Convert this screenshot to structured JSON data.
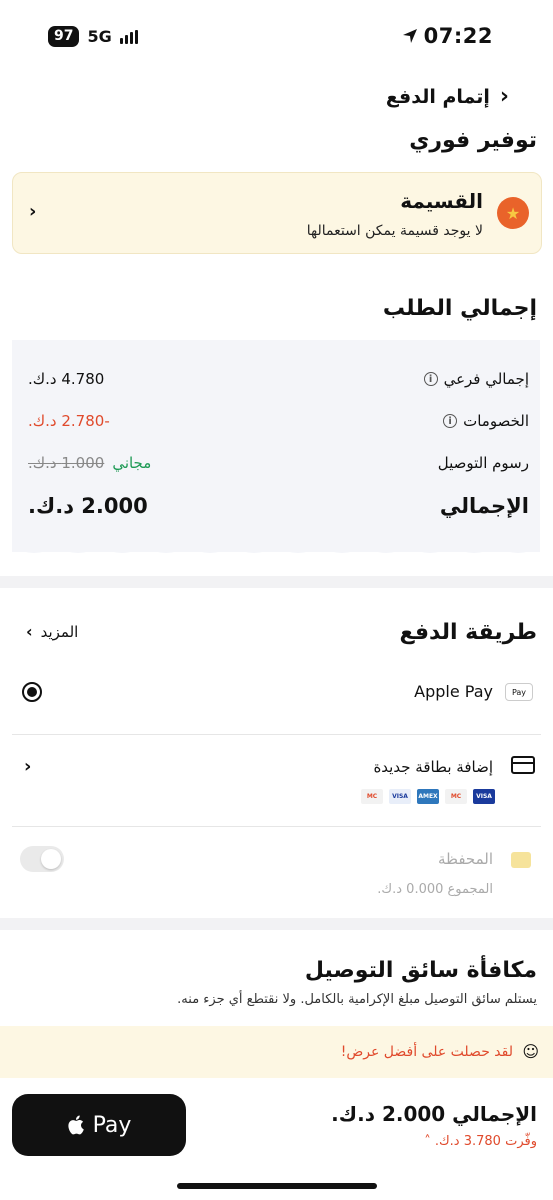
{
  "status_bar": {
    "battery": "97",
    "network": "5G",
    "time": "07:22"
  },
  "header": {
    "title": "إتمام الدفع"
  },
  "instant_savings": {
    "title": "توفير فوري",
    "coupon_title": "القسيمة",
    "coupon_subtitle": "لا يوجد قسيمة يمكن استعمالها"
  },
  "order_summary": {
    "title": "إجمالي الطلب",
    "rows": [
      {
        "label": "إجمالي فرعي",
        "value": "4.780 د.ك."
      },
      {
        "label": "الخصومات",
        "value": "-2.780 د.ك."
      },
      {
        "label": "رسوم التوصيل",
        "original": "1.000 د.ك.",
        "value": "مجاني"
      }
    ],
    "total_label": "الإجمالي",
    "total_value": "2.000 د.ك."
  },
  "payment_method": {
    "title": "طريقة الدفع",
    "more": "المزيد",
    "apple_pay": "Apple Pay",
    "apple_pay_badge": "Pay",
    "add_card": "إضافة بطاقة جديدة",
    "card_brands": [
      "VISA",
      "MC",
      "AMEX",
      "VISA",
      "MC"
    ],
    "wallet": "المحفظة",
    "wallet_total": "المجموع 0.000 د.ك."
  },
  "driver_tip": {
    "title": "مكافأة سائق التوصيل",
    "subtitle": "يستلم سائق التوصيل مبلغ الإكرامية بالكامل. ولا نقتطع أي جزء منه.",
    "offer": "لقد حصلت على أفضل عرض!"
  },
  "bottom_bar": {
    "pay_button": "Pay",
    "total": "الإجمالي 2.000 د.ك.",
    "saved": "وفّرت 3.780 د.ك."
  },
  "colors": {
    "accent_red": "#e04a2c",
    "free_green": "#1e9a55",
    "coupon_bg": "#fdf7e3"
  }
}
